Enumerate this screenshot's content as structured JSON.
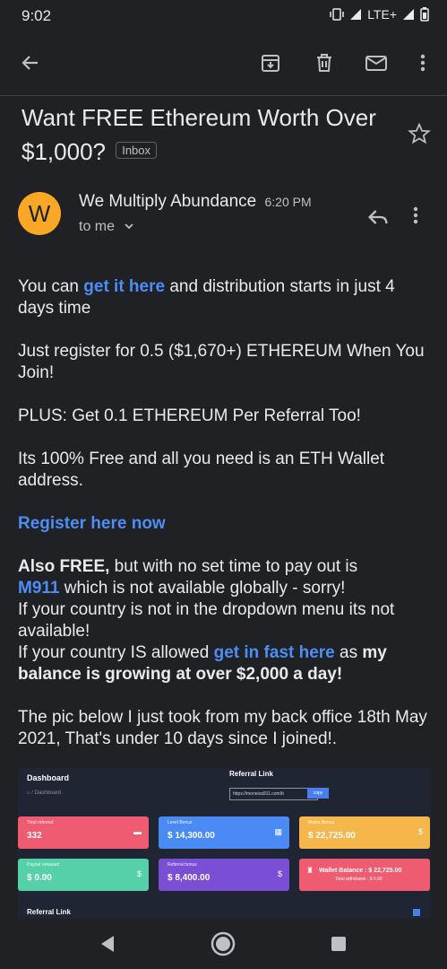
{
  "status_bar": {
    "time": "9:02",
    "network": "LTE+"
  },
  "toolbar": {
    "back_icon": "arrow-left-icon",
    "archive_icon": "archive-icon",
    "delete_icon": "trash-icon",
    "mark_unread_icon": "mail-icon",
    "more_icon": "more-vert-icon"
  },
  "email": {
    "subject": "Want FREE Ethereum Worth Over $1,000?",
    "label": "Inbox",
    "sender_initial": "W",
    "sender_name": "We Multiply Abundance",
    "time": "6:20 PM",
    "recipient": "to me",
    "accent_color": "#f9a825",
    "link_color": "#4c8df6"
  },
  "body": {
    "p1_a": "You can ",
    "p1_link": "get it here",
    "p1_b": " and distribution starts in just 4 days time",
    "p2": "Just register for 0.5 ($1,670+) ETHEREUM When You Join!",
    "p3": "PLUS: Get 0.1 ETHEREUM Per Referral Too!",
    "p4": "Its 100% Free and all you need is an ETH Wallet address.",
    "p5_link": "Register here now",
    "p6_bold": "Also FREE,",
    "p6_a": " but with no set time to pay out is",
    "p6_link": "M911",
    "p6_b": " which is not available globally - sorry!",
    "p6_c": "If your country is not in the dropdown menu its not available!",
    "p6_d": "If your country IS allowed ",
    "p6_link2": "get in fast here",
    "p6_e": " as ",
    "p6_bold2": "my balance is growing at over $2,000 a day!",
    "p7": "The pic below I just took from my back office 18th May 2021, That's under 10 days since I joined!."
  },
  "embedded_image": {
    "dashboard_title": "Dashboard",
    "breadcrumb": "⌂ / Dashboard",
    "referral_title": "Referral Link",
    "referral_url": "https://moneiza911.com/b",
    "copy_label": "copy",
    "cards": [
      {
        "label": "Total referred",
        "value": "332",
        "color": "#ef5b70"
      },
      {
        "label": "Level Bonus",
        "value": "$ 14,300.00",
        "color": "#4a8af4"
      },
      {
        "label": "Matrix Bonus",
        "value": "$ 22,725.00",
        "color": "#f5b74c"
      },
      {
        "label": "Payout released",
        "value": "$ 0.00",
        "color": "#55d0a8"
      },
      {
        "label": "Referral bonus",
        "value": "$ 8,400.00",
        "color": "#7a4fd6"
      },
      {
        "label": "",
        "value": "",
        "color": "#ef5b70"
      }
    ],
    "wallet_balance": "Wallet Balance : $ 22,725.00",
    "total_withdrawn": "Total withdrawn : $ 0.00",
    "referral_link_footer": "Referral Link"
  },
  "navigation": {
    "back_icon": "nav-back-icon",
    "home_icon": "nav-home-icon",
    "recents_icon": "nav-recents-icon"
  }
}
